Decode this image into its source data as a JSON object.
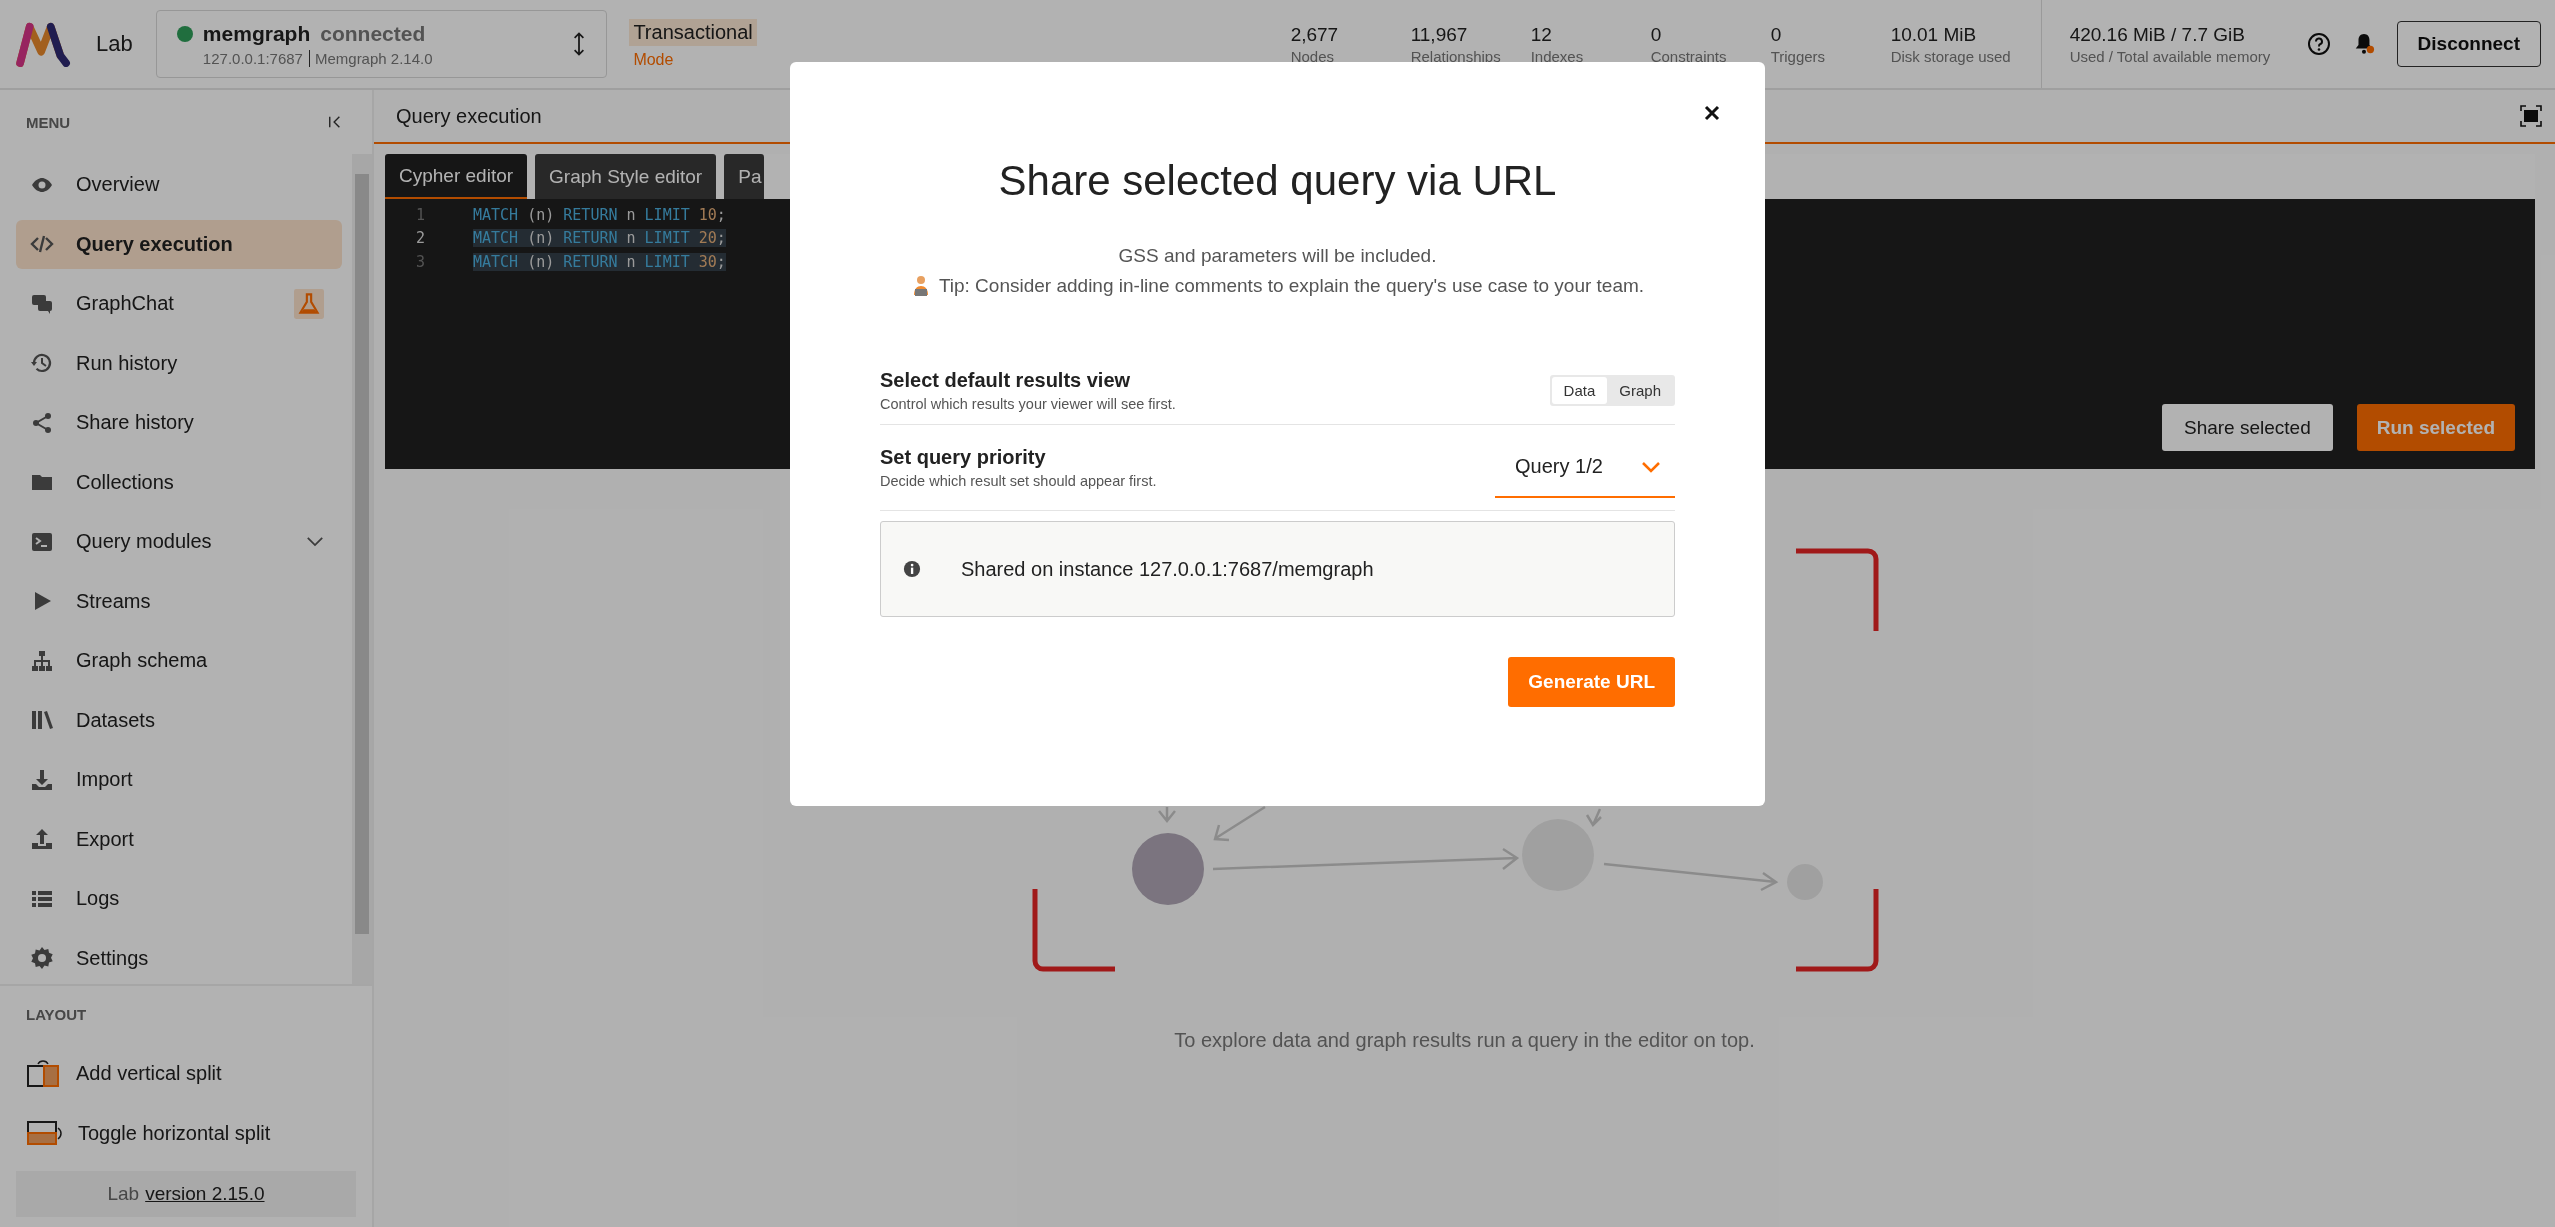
{
  "app": {
    "name": "Lab"
  },
  "connection": {
    "name": "memgraph",
    "status": "connected",
    "connected": true,
    "address": "127.0.0.1:7687",
    "version": "Memgraph 2.14.0"
  },
  "mode": {
    "value": "Transactional",
    "label": "Mode"
  },
  "stats": [
    {
      "value": "2,677",
      "label": "Nodes"
    },
    {
      "value": "11,967",
      "label": "Relationships"
    },
    {
      "value": "12",
      "label": "Indexes"
    },
    {
      "value": "0",
      "label": "Constraints"
    },
    {
      "value": "0",
      "label": "Triggers"
    },
    {
      "value": "10.01 MiB",
      "label": "Disk storage used"
    }
  ],
  "memory": {
    "value": "420.16 MiB / 7.7 GiB",
    "label": "Used / Total available memory"
  },
  "notifications": {
    "unread": true
  },
  "disconnect_button": "Disconnect",
  "sidebar": {
    "heading": "MENU",
    "items": [
      {
        "label": "Overview",
        "selected": false,
        "experimental": false,
        "expandable": false
      },
      {
        "label": "Query execution",
        "selected": true,
        "experimental": false,
        "expandable": false
      },
      {
        "label": "GraphChat",
        "selected": false,
        "experimental": true,
        "expandable": false
      },
      {
        "label": "Run history",
        "selected": false,
        "experimental": false,
        "expandable": false
      },
      {
        "label": "Share history",
        "selected": false,
        "experimental": false,
        "expandable": false
      },
      {
        "label": "Collections",
        "selected": false,
        "experimental": false,
        "expandable": false
      },
      {
        "label": "Query modules",
        "selected": false,
        "experimental": false,
        "expandable": true
      },
      {
        "label": "Streams",
        "selected": false,
        "experimental": false,
        "expandable": false
      },
      {
        "label": "Graph schema",
        "selected": false,
        "experimental": false,
        "expandable": false
      },
      {
        "label": "Datasets",
        "selected": false,
        "experimental": false,
        "expandable": false
      },
      {
        "label": "Import",
        "selected": false,
        "experimental": false,
        "expandable": false
      },
      {
        "label": "Export",
        "selected": false,
        "experimental": false,
        "expandable": false
      },
      {
        "label": "Logs",
        "selected": false,
        "experimental": false,
        "expandable": false
      },
      {
        "label": "Settings",
        "selected": false,
        "experimental": false,
        "expandable": false
      }
    ],
    "layout_heading": "LAYOUT",
    "layout_items": [
      "Add vertical split",
      "Toggle horizontal split"
    ],
    "footer": {
      "prefix": "Lab",
      "link": "version 2.15.0"
    }
  },
  "panel": {
    "title": "Query execution",
    "tabs": [
      {
        "label": "Cypher editor",
        "selected": true
      },
      {
        "label": "Graph Style editor",
        "selected": false
      },
      {
        "label": "Pa",
        "selected": false
      }
    ],
    "editor": {
      "lines": [
        {
          "number": "1",
          "code": "MATCH (n) RETURN n LIMIT 10;",
          "selected": false,
          "current": false
        },
        {
          "number": "2",
          "code": "MATCH (n) RETURN n LIMIT 20;",
          "selected": true,
          "current": true
        },
        {
          "number": "3",
          "code": "MATCH (n) RETURN n LIMIT 30;",
          "selected": true,
          "current": false
        }
      ]
    },
    "share_button": "Share selected",
    "run_button": "Run selected"
  },
  "empty_state": {
    "message": "To explore data and graph results run a query in the editor on top."
  },
  "modal": {
    "title": "Share selected query via URL",
    "note": "GSS and parameters will be included.",
    "tip": "Tip: Consider adding in-line comments to explain the query's use case to your team.",
    "results_view": {
      "title": "Select default results view",
      "description": "Control which results your viewer will see first.",
      "options": [
        {
          "label": "Data",
          "selected": true
        },
        {
          "label": "Graph",
          "selected": false
        }
      ]
    },
    "priority": {
      "title": "Set query priority",
      "description": "Decide which result set should appear first.",
      "value": "Query 1/2"
    },
    "info": "Shared on instance 127.0.0.1:7687/memgraph",
    "generate_button": "Generate URL"
  }
}
